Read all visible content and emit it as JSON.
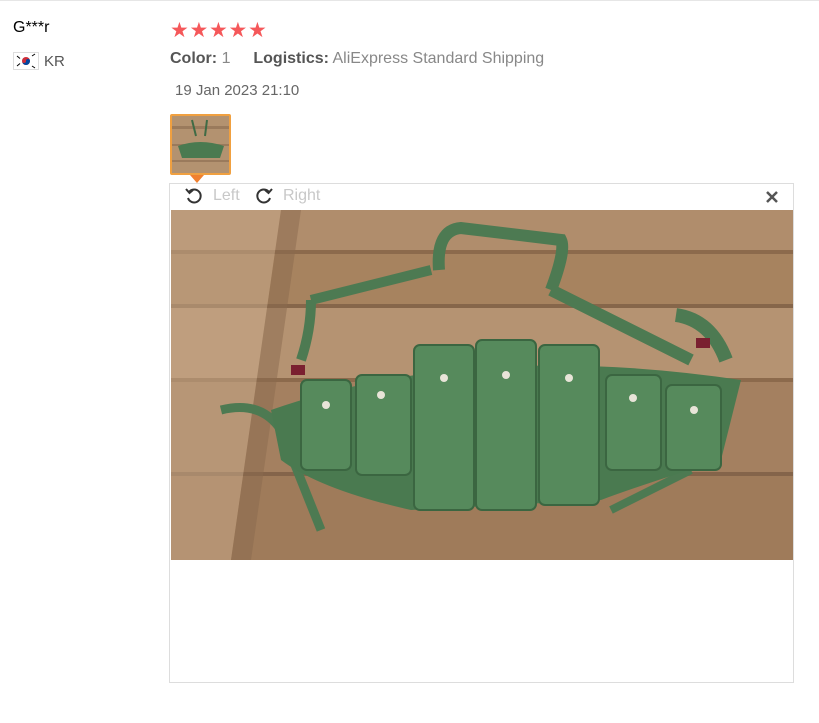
{
  "review": {
    "username": "G***r",
    "country_code": "KR",
    "rating": 5,
    "color_label": "Color:",
    "color_value": "1",
    "logistics_label": "Logistics:",
    "logistics_value": "AliExpress Standard Shipping",
    "date": "19 Jan 2023 21:10"
  },
  "viewer": {
    "rotate_left_label": "Left",
    "rotate_right_label": "Right"
  },
  "icons": {
    "flag": "south-korea-flag-icon",
    "rotate_left": "rotate-left-icon",
    "rotate_right": "rotate-right-icon",
    "close": "close-icon",
    "star": "star-icon"
  },
  "colors": {
    "star": "#f5585a",
    "thumb_border": "#f0a040"
  }
}
